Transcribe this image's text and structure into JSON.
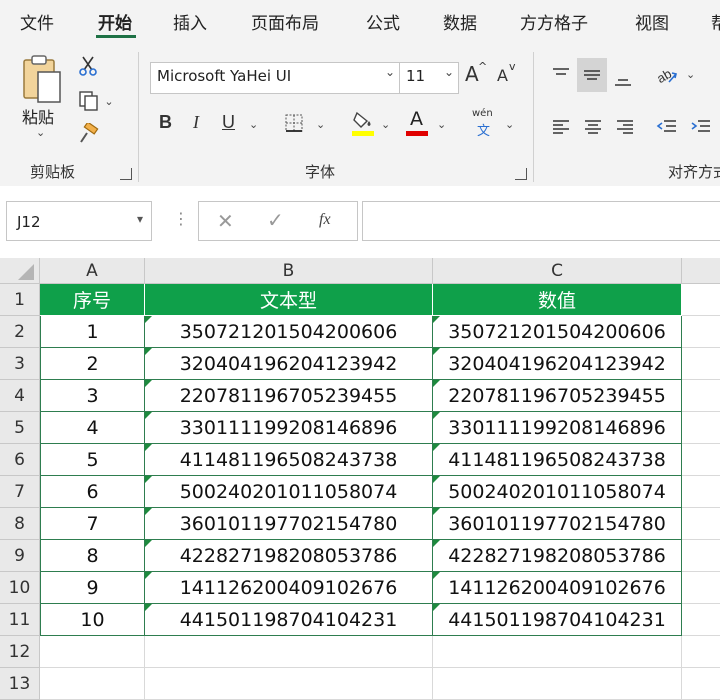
{
  "menu": {
    "tabs": [
      "文件",
      "开始",
      "插入",
      "页面布局",
      "公式",
      "数据",
      "方方格子",
      "视图",
      "帮"
    ],
    "active": "开始"
  },
  "ribbon": {
    "clipboard": {
      "paste_label": "粘贴",
      "group_label": "剪贴板"
    },
    "font": {
      "font_name": "Microsoft YaHei UI",
      "font_size": "11",
      "bold": "B",
      "italic": "I",
      "underline": "U",
      "grow_font": "A",
      "shrink_font": "A",
      "font_color_letter": "A",
      "fill_color": "#ffff00",
      "font_color": "#e00000",
      "phonetic_top": "wén",
      "phonetic_bottom": "文",
      "group_label": "字体"
    },
    "alignment": {
      "group_label": "对齐方式"
    }
  },
  "formula_bar": {
    "name_box": "J12",
    "fx_label": "fx",
    "formula": ""
  },
  "sheet": {
    "columns": [
      "A",
      "B",
      "C"
    ],
    "header_fill": "#0fa04a",
    "headers": [
      "序号",
      "文本型",
      "数值"
    ],
    "row_numbers": [
      "1",
      "2",
      "3",
      "4",
      "5",
      "6",
      "7",
      "8",
      "9",
      "10",
      "11",
      "12",
      "13"
    ],
    "rows": [
      [
        "1",
        "350721201504200606",
        "350721201504200606"
      ],
      [
        "2",
        "320404196204123942",
        "320404196204123942"
      ],
      [
        "3",
        "220781196705239455",
        "220781196705239455"
      ],
      [
        "4",
        "330111199208146896",
        "330111199208146896"
      ],
      [
        "5",
        "411481196508243738",
        "411481196508243738"
      ],
      [
        "6",
        "500240201011058074",
        "500240201011058074"
      ],
      [
        "7",
        "360101197702154780",
        "360101197702154780"
      ],
      [
        "8",
        "422827198208053786",
        "422827198208053786"
      ],
      [
        "9",
        "141126200409102676",
        "141126200409102676"
      ],
      [
        "10",
        "441501198704104231",
        "441501198704104231"
      ]
    ]
  }
}
